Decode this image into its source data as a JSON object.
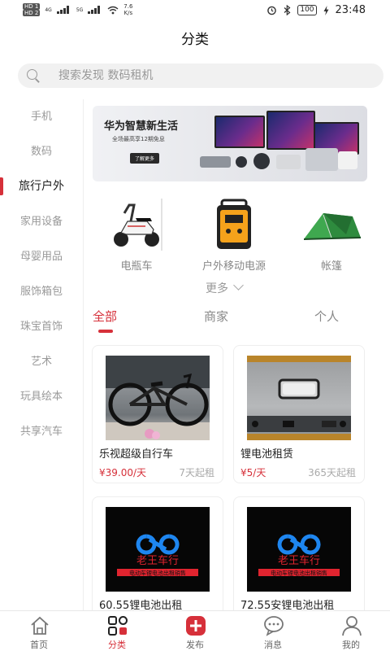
{
  "status_bar": {
    "net_top": "HD 1",
    "net_bottom": "HD 2",
    "gen1": "4G",
    "gen2": "5G",
    "speed_value": "7.6",
    "speed_unit": "K/s",
    "battery": "100",
    "time": "23:48"
  },
  "header": {
    "title": "分类"
  },
  "search": {
    "placeholder": "搜索发现 数码租机"
  },
  "sidebar": {
    "items": [
      {
        "label": "手机"
      },
      {
        "label": "数码"
      },
      {
        "label": "旅行户外"
      },
      {
        "label": "家用设备"
      },
      {
        "label": "母婴用品"
      },
      {
        "label": "服饰箱包"
      },
      {
        "label": "珠宝首饰"
      },
      {
        "label": "艺术"
      },
      {
        "label": "玩具绘本"
      },
      {
        "label": "共享汽车"
      }
    ],
    "active_index": 2
  },
  "banner": {
    "title": "华为智慧新生活",
    "subtitle": "全场最高享12期免息",
    "button": "了解更多"
  },
  "categories": [
    {
      "label": "电瓶车"
    },
    {
      "label": "户外移动电源"
    },
    {
      "label": "帐篷"
    }
  ],
  "more_label": "更多",
  "tabs": [
    {
      "label": "全部"
    },
    {
      "label": "商家"
    },
    {
      "label": "个人"
    }
  ],
  "products": [
    {
      "title": "乐视超级自行车",
      "price": "¥39.00/天",
      "min": "7天起租"
    },
    {
      "title": "锂电池租赁",
      "price": "¥5/天",
      "min": "365天起租"
    },
    {
      "title": "60.55锂电池出租",
      "logo_text": "老王车行",
      "logo_sub": "电动车锂电池出租销售"
    },
    {
      "title": "72.55安锂电池出租",
      "logo_text": "老王车行",
      "logo_sub": "电动车锂电池出租销售"
    }
  ],
  "bottom_nav": [
    {
      "label": "首页",
      "icon": "home-icon"
    },
    {
      "label": "分类",
      "icon": "category-icon"
    },
    {
      "label": "发布",
      "icon": "publish-icon"
    },
    {
      "label": "消息",
      "icon": "message-icon"
    },
    {
      "label": "我的",
      "icon": "profile-icon"
    }
  ],
  "colors": {
    "accent": "#d6303a",
    "muted": "#999999",
    "logo_blue": "#1e86f0",
    "logo_red": "#e0242f"
  }
}
